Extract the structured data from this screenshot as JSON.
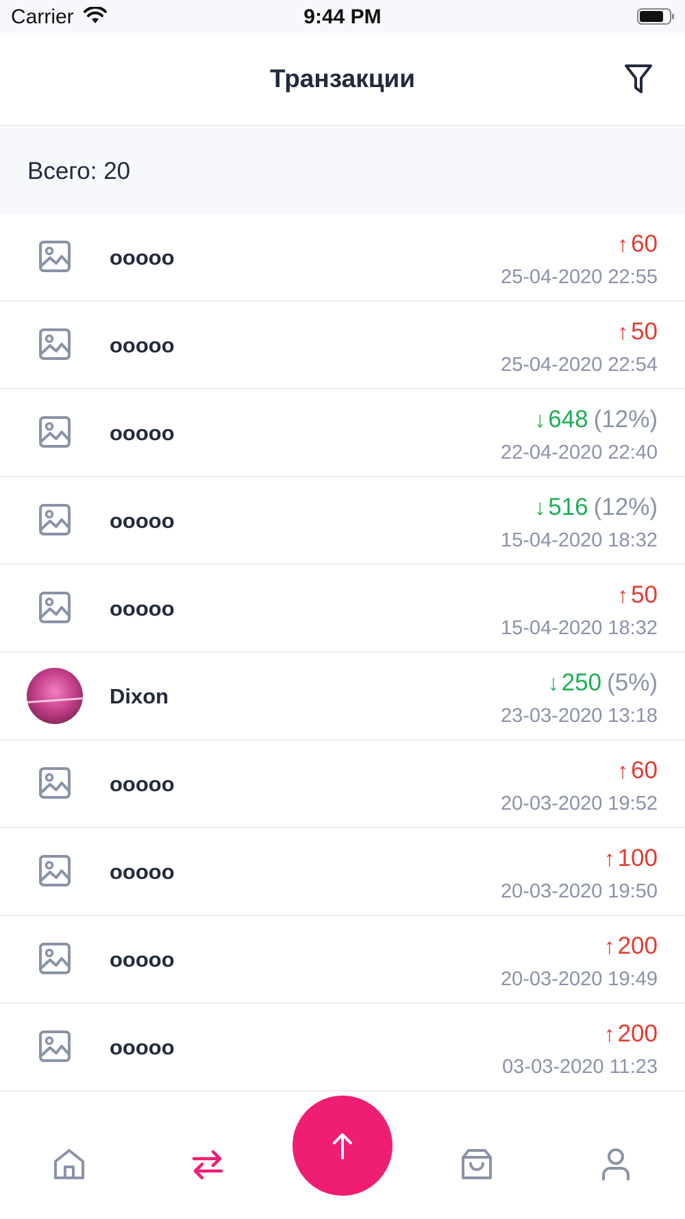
{
  "status_bar": {
    "carrier": "Carrier",
    "time": "9:44 PM"
  },
  "header": {
    "title": "Транзакции",
    "filter_icon": "filter-icon"
  },
  "summary": {
    "total_text": "Всего: 20"
  },
  "colors": {
    "accent": "#ef1d73",
    "outgoing": "#e23b2f",
    "incoming": "#1cae55",
    "muted": "#8a92a8",
    "text": "#232a3d"
  },
  "transactions": [
    {
      "name": "ooooo",
      "direction": "out",
      "arrow": "↑",
      "amount": "60",
      "percent": "",
      "date": "25-04-2020 22:55",
      "icon": "image-icon"
    },
    {
      "name": "ooooo",
      "direction": "out",
      "arrow": "↑",
      "amount": "50",
      "percent": "",
      "date": "25-04-2020 22:54",
      "icon": "image-icon"
    },
    {
      "name": "ooooo",
      "direction": "in",
      "arrow": "↓",
      "amount": "648",
      "percent": "(12%)",
      "date": "22-04-2020 22:40",
      "icon": "image-icon"
    },
    {
      "name": "ooooo",
      "direction": "in",
      "arrow": "↓",
      "amount": "516",
      "percent": "(12%)",
      "date": "15-04-2020 18:32",
      "icon": "image-icon"
    },
    {
      "name": "ooooo",
      "direction": "out",
      "arrow": "↑",
      "amount": "50",
      "percent": "",
      "date": "15-04-2020 18:32",
      "icon": "image-icon"
    },
    {
      "name": "Dixon",
      "direction": "in",
      "arrow": "↓",
      "amount": "250",
      "percent": "(5%)",
      "date": "23-03-2020 13:18",
      "icon": "avatar"
    },
    {
      "name": "ooooo",
      "direction": "out",
      "arrow": "↑",
      "amount": "60",
      "percent": "",
      "date": "20-03-2020 19:52",
      "icon": "image-icon"
    },
    {
      "name": "ooooo",
      "direction": "out",
      "arrow": "↑",
      "amount": "100",
      "percent": "",
      "date": "20-03-2020 19:50",
      "icon": "image-icon"
    },
    {
      "name": "ooooo",
      "direction": "out",
      "arrow": "↑",
      "amount": "200",
      "percent": "",
      "date": "20-03-2020 19:49",
      "icon": "image-icon"
    },
    {
      "name": "ooooo",
      "direction": "out",
      "arrow": "↑",
      "amount": "200",
      "percent": "",
      "date": "03-03-2020 11:23",
      "icon": "image-icon"
    }
  ],
  "tab_bar": {
    "tabs": [
      {
        "icon": "home-icon",
        "active": false
      },
      {
        "icon": "transfer-arrows-icon",
        "active": true
      },
      {
        "icon": "send-up-arrow-icon",
        "active": false
      },
      {
        "icon": "shopping-bag-icon",
        "active": false
      },
      {
        "icon": "user-icon",
        "active": false
      }
    ]
  }
}
